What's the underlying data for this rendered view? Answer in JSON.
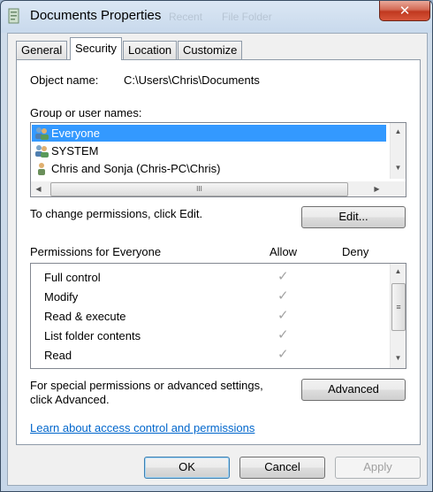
{
  "window": {
    "title": "Documents Properties",
    "ghost_text_1": "Recent",
    "ghost_text_2": "File Folder",
    "close_label": "✕"
  },
  "tabs": [
    {
      "label": "General"
    },
    {
      "label": "Security",
      "active": true
    },
    {
      "label": "Location"
    },
    {
      "label": "Customize"
    }
  ],
  "security": {
    "object_name_label": "Object name:",
    "object_name_value": "C:\\Users\\Chris\\Documents",
    "group_label": "Group or user names:",
    "groups": [
      {
        "name": "Everyone",
        "icon": "group-users-icon",
        "selected": true
      },
      {
        "name": "SYSTEM",
        "icon": "group-users-icon",
        "selected": false
      },
      {
        "name": "Chris and Sonja (Chris-PC\\Chris)",
        "icon": "user-icon",
        "selected": false
      }
    ],
    "hscroll_grip": "III",
    "change_hint": "To change permissions, click Edit.",
    "edit_button": "Edit...",
    "permissions_label": "Permissions for Everyone",
    "allow_header": "Allow",
    "deny_header": "Deny",
    "permissions": [
      {
        "name": "Full control",
        "allow": true,
        "deny": false
      },
      {
        "name": "Modify",
        "allow": true,
        "deny": false
      },
      {
        "name": "Read & execute",
        "allow": true,
        "deny": false
      },
      {
        "name": "List folder contents",
        "allow": true,
        "deny": false
      },
      {
        "name": "Read",
        "allow": true,
        "deny": false
      }
    ],
    "check_glyph": "✓",
    "special_hint_line1": "For special permissions or advanced settings,",
    "special_hint_line2": "click Advanced.",
    "advanced_button": "Advanced",
    "learn_link": "Learn about access control and permissions"
  },
  "footer": {
    "ok": "OK",
    "cancel": "Cancel",
    "apply": "Apply"
  },
  "colors": {
    "selection": "#3399ff",
    "link": "#0066cc",
    "close_button": "#c0381f"
  }
}
